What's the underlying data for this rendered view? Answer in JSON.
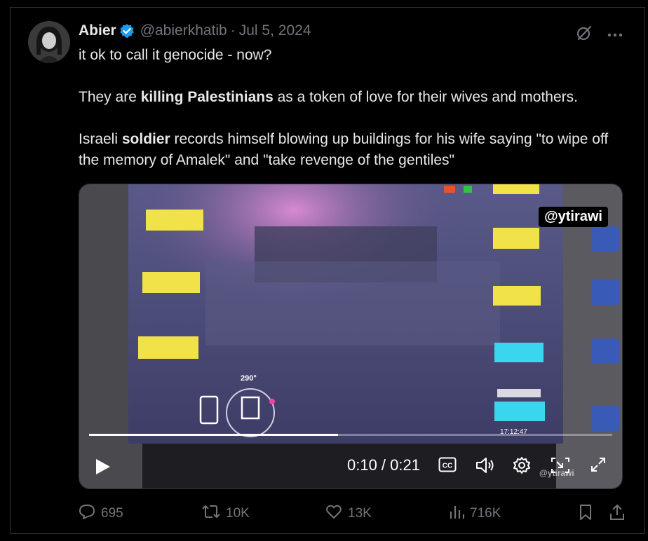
{
  "author": {
    "name": "Abier",
    "handle": "@abierkhatib",
    "separator": "·",
    "date": "Jul 5, 2024"
  },
  "tweet": {
    "line1": "it ok to call it genocide - now?",
    "line2_pre": "They are ",
    "line2_bold": "killing Palestinians",
    "line2_post": " as a token of love for their wives and mothers.",
    "line3_pre": "Israeli ",
    "line3_bold": "soldier",
    "line3_post": " records himself blowing up buildings for his wife saying \"to wipe off the memory of Amalek\" and \"take revenge of the gentiles\""
  },
  "video": {
    "watermark": "@ytirawi",
    "heading_label": "290°",
    "clock": "17:12:47",
    "time_display": "0:10 / 0:21",
    "progress": 0.476,
    "cc_label": "CC",
    "corner_mark": "@ytirawi"
  },
  "stats": {
    "replies": "695",
    "reposts": "10K",
    "likes": "13K",
    "views": "716K"
  },
  "icons": {
    "verified": "verified-badge-icon",
    "grok": "grok-icon",
    "more": "more-icon",
    "reply": "reply-icon",
    "repost": "repost-icon",
    "like": "like-icon",
    "views": "views-icon",
    "bookmark": "bookmark-icon",
    "share": "share-icon"
  },
  "colors": {
    "accent": "#1d9bf0",
    "muted": "#71767b",
    "text": "#e7e9ea",
    "background": "#000000"
  }
}
